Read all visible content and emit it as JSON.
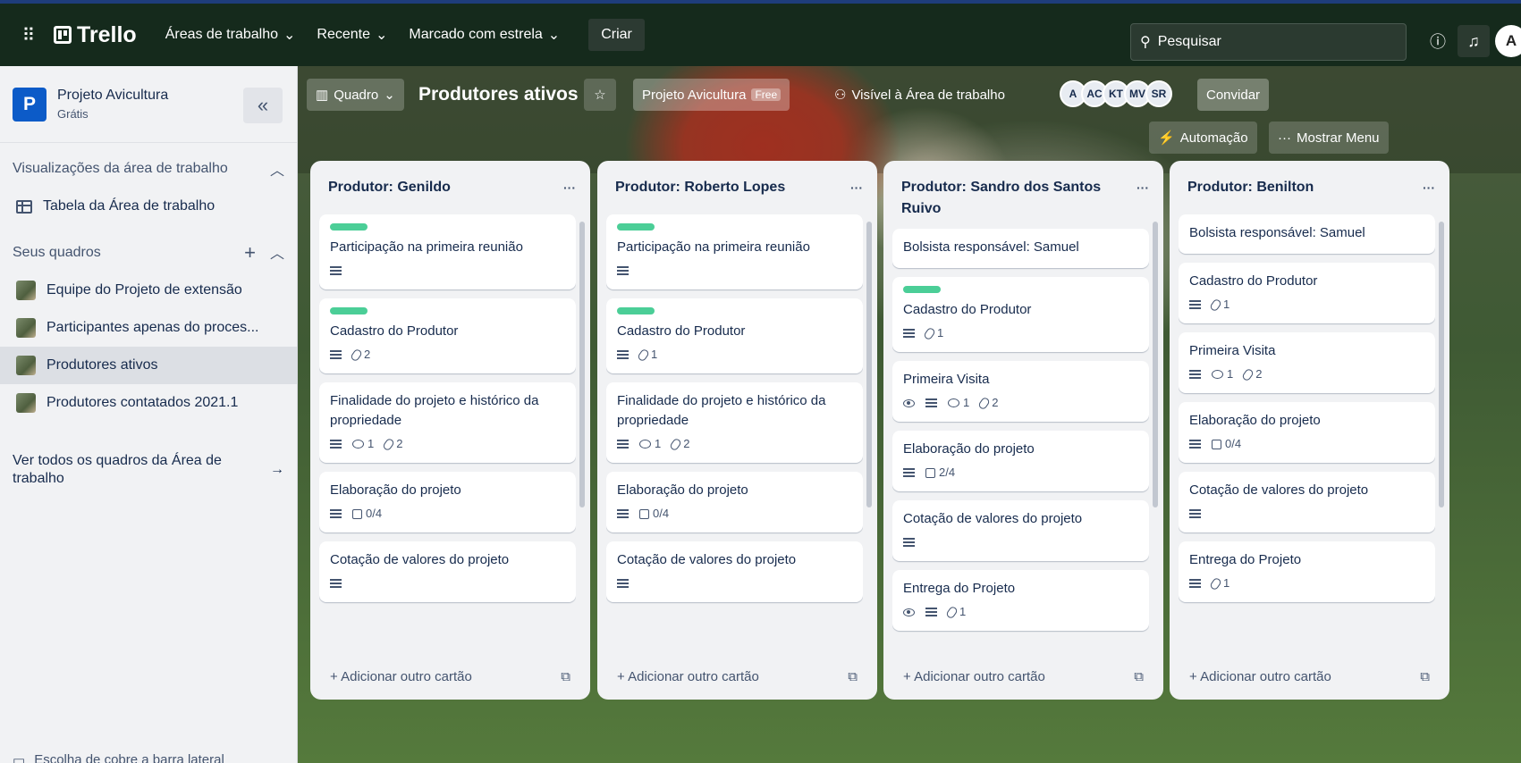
{
  "topbar": {
    "logo": "Trello",
    "menus": [
      "Áreas de trabalho",
      "Recente",
      "Marcado com estrela"
    ],
    "create": "Criar",
    "search_placeholder": "Pesquisar",
    "avatar": "A"
  },
  "sidebar": {
    "workspace_name": "Projeto Avicultura",
    "workspace_plan": "Grátis",
    "workspace_initial": "P",
    "views_section": "Visualizações da área de trabalho",
    "table_view": "Tabela da Área de trabalho",
    "boards_section": "Seus quadros",
    "boards": [
      "Equipe do Projeto de extensão",
      "Participantes apenas do proces...",
      "Produtores ativos",
      "Produtores contatados 2021.1"
    ],
    "see_all": "Ver todos os quadros da Área de trabalho",
    "bottom": "Escolha de cobre a barra lateral"
  },
  "board": {
    "view": "Quadro",
    "title": "Produtores ativos",
    "workspace": "Projeto Avicultura",
    "workspace_badge": "Free",
    "visibility": "Visível à Área de trabalho",
    "members": [
      "A",
      "AC",
      "KT",
      "MV",
      "SR"
    ],
    "invite": "Convidar",
    "automation": "Automação",
    "show_menu": "Mostrar Menu",
    "add_card": "Adicionar outro cartão"
  },
  "lists": [
    {
      "title": "Produtor: Genildo",
      "cards": [
        {
          "label": true,
          "title": "Participação na primeira reunião",
          "desc": true
        },
        {
          "label": true,
          "title": "Cadastro do Produtor",
          "desc": true,
          "attachments": "2"
        },
        {
          "title": "Finalidade do projeto e histórico da propriedade",
          "desc": true,
          "comments": "1",
          "attachments": "2"
        },
        {
          "title": "Elaboração do projeto",
          "desc": true,
          "checklist": "0/4"
        },
        {
          "title": "Cotação de valores do projeto",
          "desc": true
        }
      ]
    },
    {
      "title": "Produtor: Roberto Lopes",
      "cards": [
        {
          "label": true,
          "title": "Participação na primeira reunião",
          "desc": true
        },
        {
          "label": true,
          "title": "Cadastro do Produtor",
          "desc": true,
          "attachments": "1"
        },
        {
          "title": "Finalidade do projeto e histórico da propriedade",
          "desc": true,
          "comments": "1",
          "attachments": "2"
        },
        {
          "title": "Elaboração do projeto",
          "desc": true,
          "checklist": "0/4"
        },
        {
          "title": "Cotação de valores do projeto",
          "desc": true
        }
      ]
    },
    {
      "title": "Produtor: Sandro dos Santos Ruivo",
      "cards": [
        {
          "title": "Bolsista responsável: Samuel"
        },
        {
          "label": true,
          "title": "Cadastro do Produtor",
          "desc": true,
          "attachments": "1"
        },
        {
          "title": "Primeira Visita",
          "watch": true,
          "desc": true,
          "comments": "1",
          "attachments": "2"
        },
        {
          "title": "Elaboração do projeto",
          "desc": true,
          "checklist": "2/4"
        },
        {
          "title": "Cotação de valores do projeto",
          "desc": true
        },
        {
          "title": "Entrega do Projeto",
          "watch": true,
          "desc": true,
          "attachments": "1"
        }
      ]
    },
    {
      "title": "Produtor: Benilton",
      "cards": [
        {
          "title": "Bolsista responsável: Samuel"
        },
        {
          "title": "Cadastro do Produtor",
          "desc": true,
          "attachments": "1"
        },
        {
          "title": "Primeira Visita",
          "desc": true,
          "comments": "1",
          "attachments": "2"
        },
        {
          "title": "Elaboração do projeto",
          "desc": true,
          "checklist": "0/4"
        },
        {
          "title": "Cotação de valores do projeto",
          "desc": true
        },
        {
          "title": "Entrega do Projeto",
          "desc": true,
          "attachments": "1"
        }
      ]
    }
  ],
  "colors": {
    "topbar": "#152a1c",
    "label_green": "#4bce97",
    "workspace_logo": "#0c5bc8"
  }
}
